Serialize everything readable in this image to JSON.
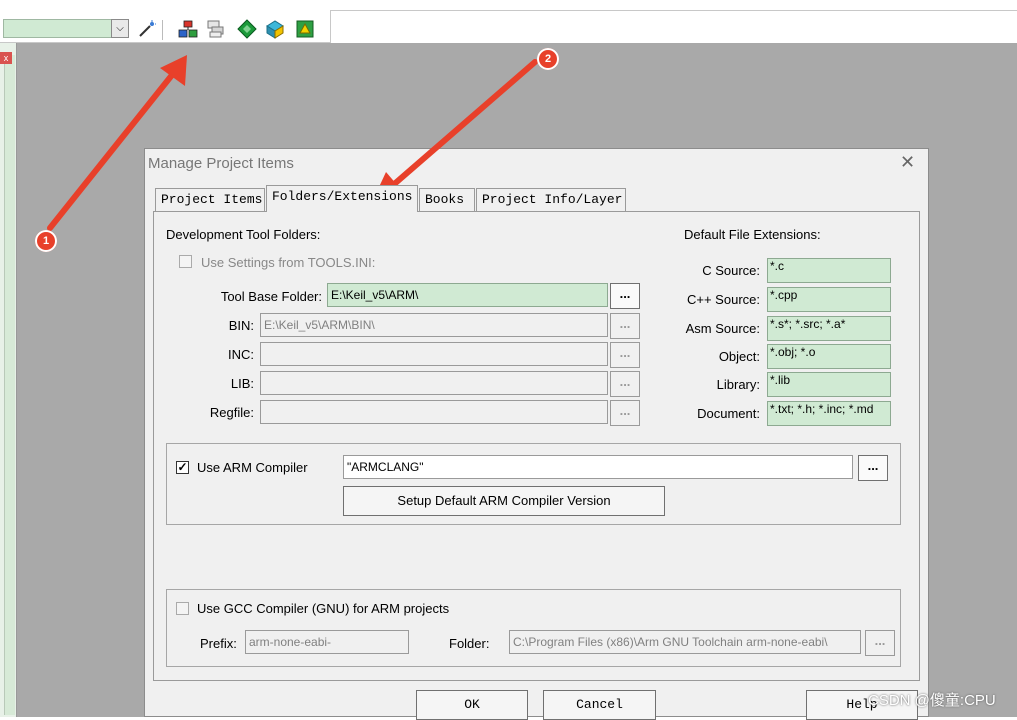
{
  "toolbar": {
    "icons": [
      "wand-icon",
      "manage-project-items-icon",
      "stacked-windows-icon",
      "diamond-icon",
      "pack-installer-icon",
      "green-box-icon"
    ]
  },
  "dialog": {
    "title": "Manage Project Items",
    "close_glyph": "✕",
    "tabs": [
      "Project Items",
      "Folders/Extensions",
      "Books",
      "Project Info/Layer"
    ],
    "active_tab": "Folders/Extensions"
  },
  "tool_folders": {
    "heading": "Development Tool Folders:",
    "use_settings_label": "Use Settings from TOOLS.INI:",
    "use_settings_checked": false,
    "tool_base_label": "Tool Base Folder:",
    "tool_base_value": "E:\\Keil_v5\\ARM\\",
    "bin_label": "BIN:",
    "bin_value": "E:\\Keil_v5\\ARM\\BIN\\",
    "inc_label": "INC:",
    "inc_value": "",
    "lib_label": "LIB:",
    "lib_value": "",
    "regfile_label": "Regfile:",
    "regfile_value": "",
    "browse_label": "..."
  },
  "extensions": {
    "heading": "Default File Extensions:",
    "items": [
      {
        "label": "C Source:",
        "value": "*.c"
      },
      {
        "label": "C++ Source:",
        "value": "*.cpp"
      },
      {
        "label": "Asm Source:",
        "value": "*.s*; *.src; *.a*"
      },
      {
        "label": "Object:",
        "value": "*.obj; *.o"
      },
      {
        "label": "Library:",
        "value": "*.lib"
      },
      {
        "label": "Document:",
        "value": "*.txt; *.h; *.inc; *.md"
      }
    ]
  },
  "arm_compiler": {
    "checkbox_label": "Use ARM Compiler",
    "checked": true,
    "check_glyph": "✓",
    "value": "\"ARMCLANG\"",
    "browse_label": "...",
    "setup_button": "Setup Default ARM Compiler Version"
  },
  "gcc_compiler": {
    "checkbox_label": "Use GCC Compiler (GNU) for ARM projects",
    "checked": false,
    "prefix_label": "Prefix:",
    "prefix_value": "arm-none-eabi-",
    "folder_label": "Folder:",
    "folder_value": "C:\\Program Files (x86)\\Arm GNU Toolchain arm-none-eabi\\",
    "browse_label": "..."
  },
  "buttons": {
    "ok": "OK",
    "cancel": "Cancel",
    "help": "Help"
  },
  "annotations": {
    "badge_1": "1",
    "badge_2": "2",
    "arrow_color": "#e8402a"
  },
  "watermark": "CSDN @傻童:CPU"
}
